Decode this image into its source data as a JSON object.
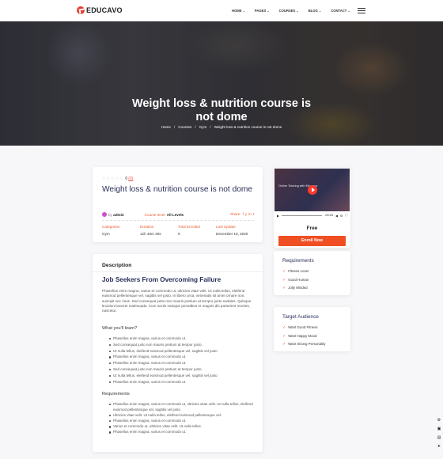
{
  "brand": {
    "name": "EDUCAVO",
    "color": "#e83a2f"
  },
  "nav": {
    "items": [
      "HOME",
      "PAGES",
      "COURSES",
      "BLOG",
      "CONTACT"
    ],
    "menu_icon": "hamburger-icon"
  },
  "hero": {
    "title_line1": "Weight loss & nutrition course is",
    "title_line2": "not dome",
    "breadcrumb": [
      "Home",
      "Courses",
      "Gym",
      "Weight loss & nutrition course is not dome"
    ]
  },
  "course": {
    "rating": "0",
    "review_count": "(0)",
    "title": "Weight loss & nutrition course is not dome",
    "by_label": "by",
    "author": "admin",
    "level_label": "Course level:",
    "level": "All Levels",
    "share_label": "Share:",
    "share_icons": [
      "f",
      "y",
      "in",
      "t"
    ],
    "stats": [
      {
        "label": "Categories",
        "value": "Gym"
      },
      {
        "label": "Duration",
        "value": "12h 40m 30s"
      },
      {
        "label": "Total Enrolled",
        "value": "0"
      },
      {
        "label": "Last Update",
        "value": "December 10, 2020"
      }
    ]
  },
  "video": {
    "overlay_text": "Online Tutoring with Educavo",
    "time": "-00:23",
    "price": "Free",
    "enroll": "Enroll Now"
  },
  "description": {
    "heading": "Description",
    "subheading": "Job Seekers From Overcoming Failure",
    "paragraph": "Phasellus enim magna, varius et commodo ut, ultricies vitae velit. Ut nulla tellus, eleifend euismod pellentesque vel, sagittis vel justo. In libero urna, venenatis sit amet ornare non, suscipit nec risus. Sed consequat justo non mauris pretium at tempor justo sodales. Quisque tincidunt laoreet malesuada. Cum sociis natoque penatibus et magnis dis parturient montes, nascetur.",
    "learn_title": "What you'll learn?",
    "learn_items": [
      "Phasellus enim magna, varius et commodo ut.",
      "Sed consequat justo non mauris pretium at tempor justo.",
      "Ut nulla tellus, eleifend euismod pellentesque vel, sagittis vel justo",
      "Phasellus enim magna, varius et commodo ut.",
      "Phasellus enim magna, varius et commodo ut.",
      "Sed consequat justo non mauris pretium at tempor justo.",
      "Ut nulla tellus, eleifend euismod pellentesque vel, sagittis vel justo",
      "Phasellus enim magna, varius et commodo ut."
    ],
    "req_title": "Requirements",
    "req_items": [
      "Phasellus enim magna, varius et commodo ut, ultricies vitae velit. Ut nulla tellus, eleifend euismod pellentesque vel, sagittis vel justo",
      "Ultricies vitae velit. Ut nulla tellus, eleifend euismod pellentesque vel.",
      "Phasellus enim magna, varius et commodo ut.",
      "Varius et commodo ut, ultricies vitae velit. Ut nulla tellus.",
      "Phasellus enim magna, varius et commodo ut."
    ]
  },
  "requirements": {
    "title": "Requirements",
    "items": [
      "Fitness Lover",
      "Good Human",
      "Jolly Minded"
    ]
  },
  "audience": {
    "title": "Target Audience",
    "items": [
      "Want Good Fitness",
      "Want Happy Mood",
      "Want Strong Personality"
    ]
  },
  "accent": "#f04e23"
}
